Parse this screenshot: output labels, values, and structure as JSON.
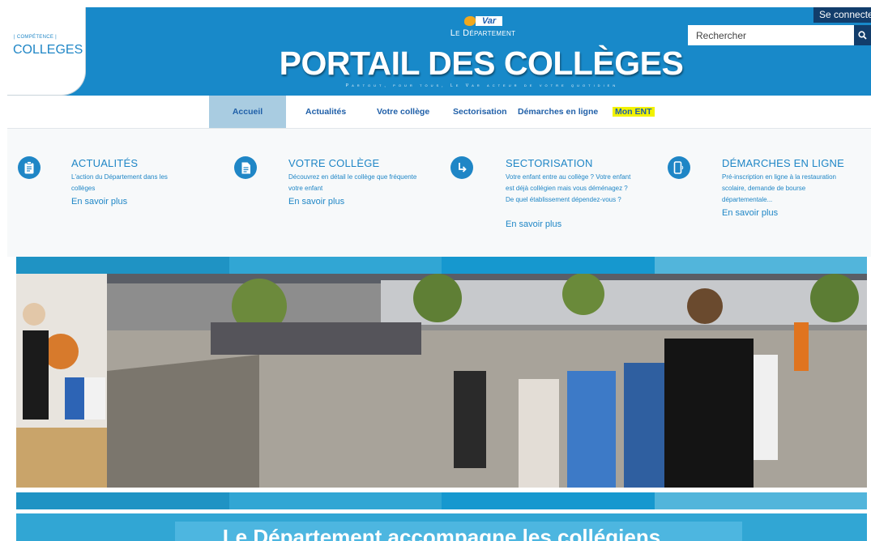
{
  "header": {
    "badge_small": "| COMPÉTENCE |",
    "badge_title": "COLLEGES",
    "logo_text": "Var",
    "department": "Le Département",
    "title": "PORTAIL DES COLLÈGES",
    "tagline": "Partout, pour tous, Le Var acteur de votre quotidien",
    "login_label": "Se connecter",
    "search_placeholder": "Rechercher",
    "search_icon": "search-icon"
  },
  "nav": {
    "items": [
      {
        "label": "Accueil",
        "active": true
      },
      {
        "label": "Actualités"
      },
      {
        "label": "Votre collège"
      },
      {
        "label": "Sectorisation"
      },
      {
        "label": "Démarches en ligne"
      },
      {
        "label": "Mon ENT",
        "highlight": "#f2f200"
      }
    ]
  },
  "features": [
    {
      "icon": "clipboard-icon",
      "title": "ACTUALITÉS",
      "desc": "L'action du Département dans les collèges",
      "more": "En savoir plus"
    },
    {
      "icon": "document-icon",
      "title": "VOTRE COLLÈGE",
      "desc": "Découvrez en détail le collège que fréquente votre enfant",
      "more": "En savoir plus"
    },
    {
      "icon": "turn-arrow-icon",
      "title": "SECTORISATION",
      "desc": "Votre enfant entre au collège ? Votre enfant est déjà collégien mais vous déménagez ? De quel établissement dépendez-vous ?",
      "more": "En savoir plus"
    },
    {
      "icon": "mobile-phone-icon",
      "title": "DÉMARCHES EN LIGNE",
      "desc": "Pré-inscription en ligne à la restauration scolaire, demande de bourse départementale...",
      "more": "En savoir plus"
    }
  ],
  "colors": {
    "brand_blue": "#1889c9",
    "dark_navy": "#123d6b",
    "accent_yellow": "#f2f200",
    "stripe_colors": [
      "#1f93c4",
      "#31a6d4",
      "#1698cf",
      "#52b5db"
    ]
  },
  "banner": {
    "text": "Le Département accompagne les collégiens"
  }
}
